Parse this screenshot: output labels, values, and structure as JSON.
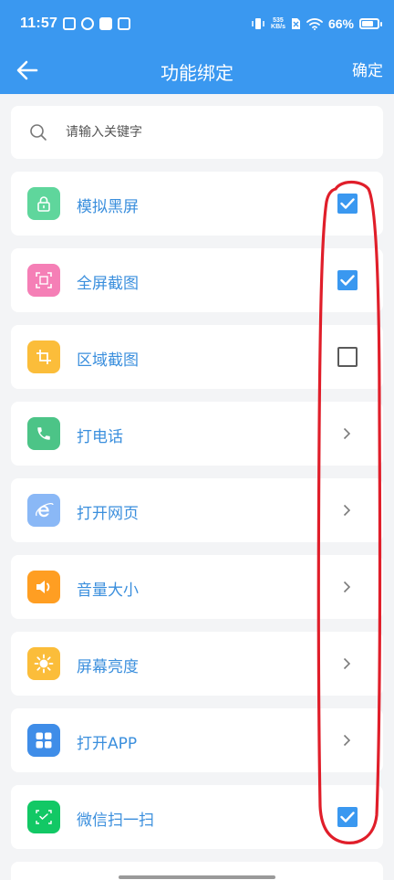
{
  "status_bar": {
    "time": "11:57",
    "net_speed_value": "535",
    "net_speed_unit": "KB/s",
    "battery_percent": "66%",
    "battery_level": 0.66
  },
  "nav": {
    "title": "功能绑定",
    "confirm_label": "确定",
    "back_icon": "arrow-left-icon"
  },
  "search": {
    "placeholder": "请输入关键字",
    "value": ""
  },
  "items": [
    {
      "label": "模拟黑屏",
      "icon": "lock-icon",
      "icon_color": "#5fd69c",
      "control": "checkbox",
      "checked": true
    },
    {
      "label": "全屏截图",
      "icon": "fullscreen-screenshot-icon",
      "icon_color": "#f57fb6",
      "control": "checkbox",
      "checked": true
    },
    {
      "label": "区域截图",
      "icon": "crop-icon",
      "icon_color": "#fbbd3a",
      "control": "checkbox",
      "checked": false
    },
    {
      "label": "打电话",
      "icon": "phone-icon",
      "icon_color": "#4cc487",
      "control": "chevron"
    },
    {
      "label": "打开网页",
      "icon": "browser-icon",
      "icon_color": "#8ab8f6",
      "control": "chevron"
    },
    {
      "label": "音量大小",
      "icon": "volume-icon",
      "icon_color": "#ff9e22",
      "control": "chevron"
    },
    {
      "label": "屏幕亮度",
      "icon": "brightness-icon",
      "icon_color": "#fbbd3a",
      "control": "chevron"
    },
    {
      "label": "打开APP",
      "icon": "apps-icon",
      "icon_color": "#3f8de8",
      "control": "chevron"
    },
    {
      "label": "微信扫一扫",
      "icon": "scan-icon",
      "icon_color": "#12c865",
      "control": "checkbox",
      "checked": true
    }
  ],
  "colors": {
    "primary": "#3a98f0",
    "label_text": "#3b8fdd",
    "annotation": "#e01e2a"
  }
}
